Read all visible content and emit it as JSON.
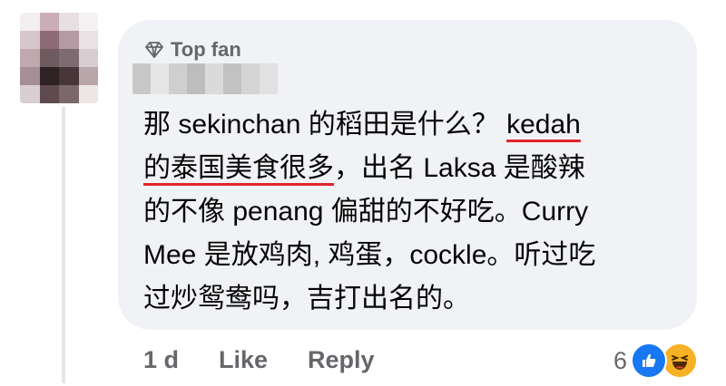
{
  "comment": {
    "badge_label": "Top fan",
    "lines": [
      {
        "segments": [
          "那 sekinchan 的稻田是什么？ ",
          "kedah"
        ]
      },
      {
        "segments": [
          "的泰国美食很多",
          "，出名 Laksa 是酸辣"
        ]
      },
      {
        "segments": [
          "的不像 penang 偏甜的不好吃。Curry"
        ]
      },
      {
        "segments": [
          "Mee 是放鸡肉, 鸡蛋，cockle。听过吃"
        ]
      },
      {
        "segments": [
          "过炒鸳鸯吗，吉打出名的。"
        ]
      }
    ],
    "underline_color": "#e0242b"
  },
  "actions": {
    "time": "1 d",
    "like_label": "Like",
    "reply_label": "Reply"
  },
  "reactions": {
    "count": "6",
    "icons": [
      "like-icon",
      "haha-icon"
    ]
  },
  "colors": {
    "bubble": "#f0f2f5",
    "text": "#050505",
    "secondary_text": "#65676b",
    "like_blue": "#1877f2",
    "haha_yellow": "#f7b125"
  }
}
